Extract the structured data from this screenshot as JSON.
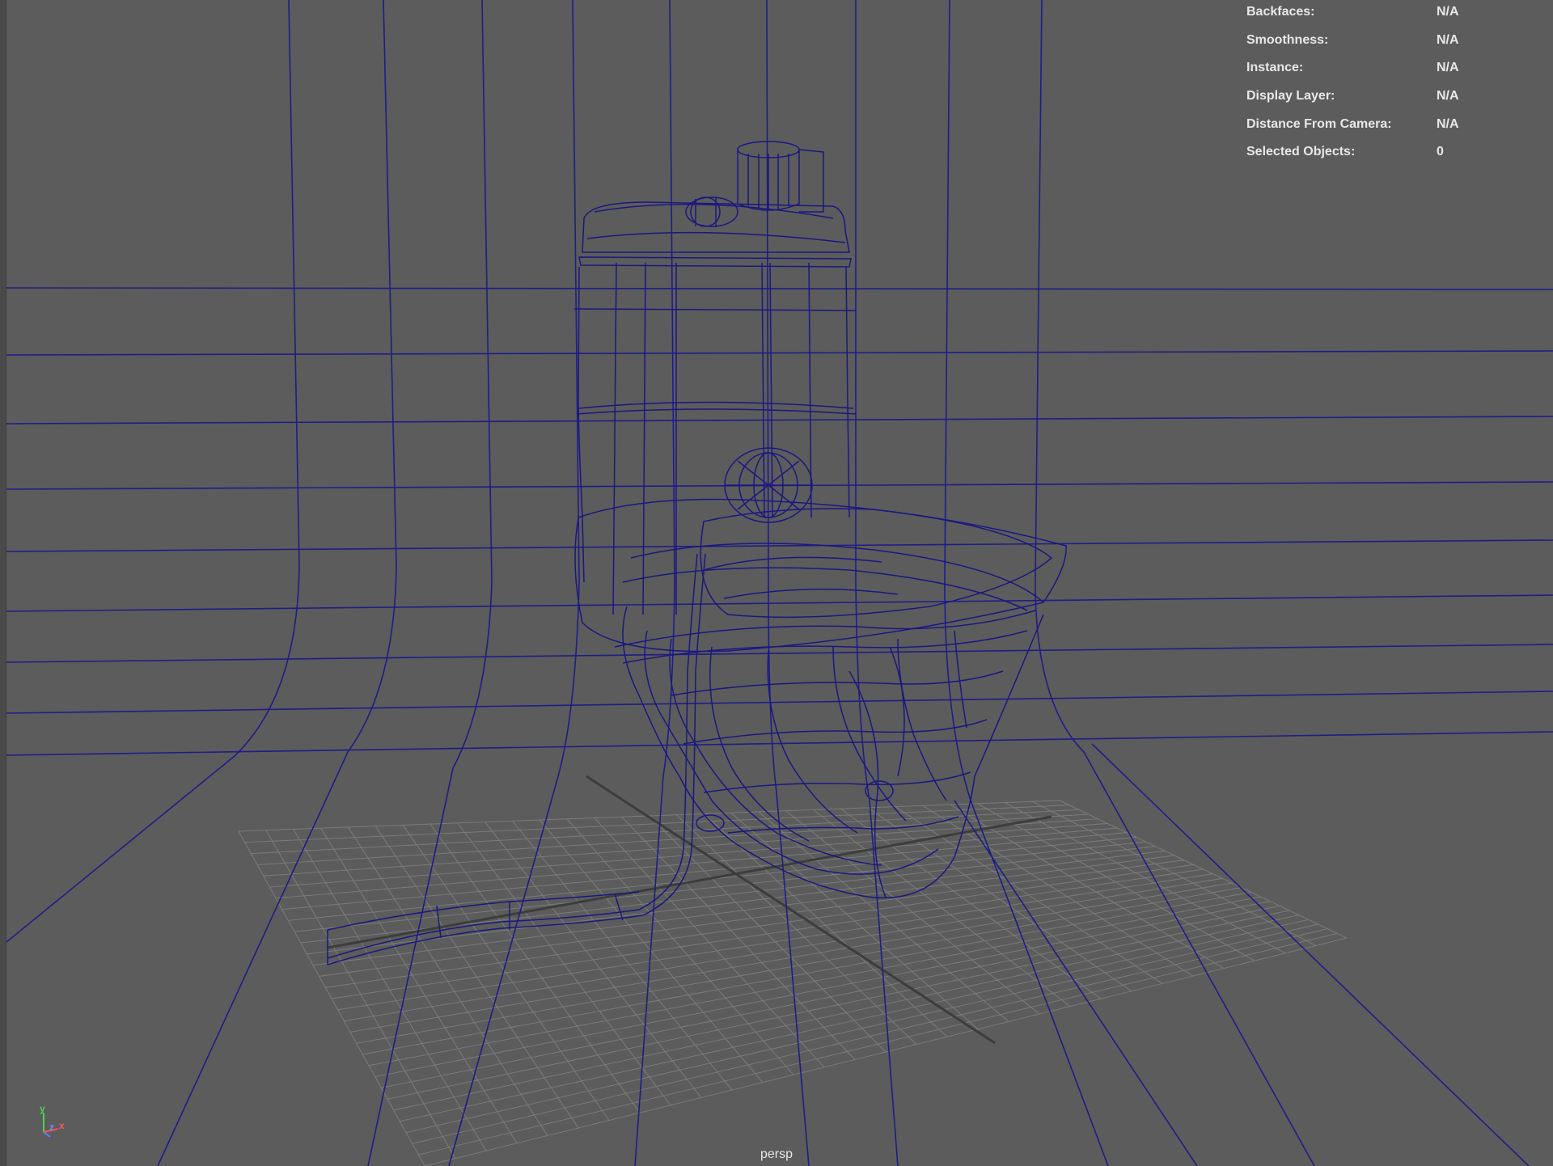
{
  "hud": {
    "rows": [
      {
        "label": "Backfaces:",
        "value": "N/A"
      },
      {
        "label": "Smoothness:",
        "value": "N/A"
      },
      {
        "label": "Instance:",
        "value": "N/A"
      },
      {
        "label": "Display Layer:",
        "value": "N/A"
      },
      {
        "label": "Distance From Camera:",
        "value": "N/A"
      },
      {
        "label": "Selected Objects:",
        "value": "0"
      }
    ]
  },
  "viewport": {
    "camera": "persp",
    "wireframe_color": "#1c1a80",
    "grid_color": "#7a7a7a",
    "background_color": "#5c5c5c"
  },
  "axis_indicator": {
    "y": "y",
    "z": "z",
    "x": "x"
  }
}
